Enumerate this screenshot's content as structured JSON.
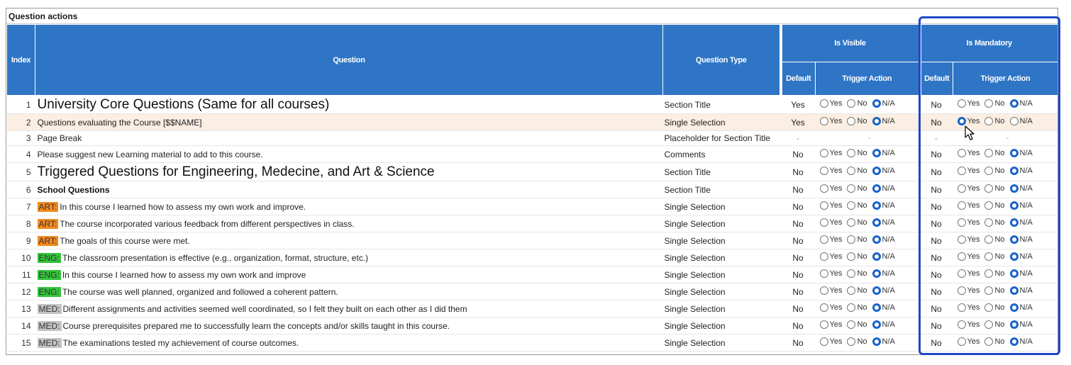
{
  "panel": {
    "title": "Question actions"
  },
  "headers": {
    "index": "Index",
    "question": "Question",
    "question_type": "Question Type",
    "is_visible": "Is Visible",
    "is_mandatory": "Is Mandatory",
    "default": "Default",
    "trigger_action": "Trigger Action"
  },
  "radio_labels": {
    "yes": "Yes",
    "no": "No",
    "na": "N/A"
  },
  "rows": [
    {
      "index": "1",
      "question": "University Core Questions (Same for all courses)",
      "tag": "",
      "style": "big",
      "type": "Section Title",
      "vis_default": "Yes",
      "vis_trigger": "na",
      "man_default": "No",
      "man_trigger": "na",
      "highlight": false,
      "dash": false
    },
    {
      "index": "2",
      "question": "Questions evaluating the Course [$$NAME]",
      "tag": "",
      "style": "",
      "type": "Single Selection",
      "vis_default": "Yes",
      "vis_trigger": "na",
      "man_default": "No",
      "man_trigger": "yes",
      "highlight": true,
      "dash": false
    },
    {
      "index": "3",
      "question": "Page Break",
      "tag": "",
      "style": "sm",
      "type": "Placeholder for Section Title",
      "vis_default": "-",
      "vis_trigger": "-",
      "man_default": "-",
      "man_trigger": "-",
      "highlight": false,
      "dash": true
    },
    {
      "index": "4",
      "question": "Please suggest new Learning material to add to this course.",
      "tag": "",
      "style": "",
      "type": "Comments",
      "vis_default": "No",
      "vis_trigger": "na",
      "man_default": "No",
      "man_trigger": "na",
      "highlight": false,
      "dash": false
    },
    {
      "index": "5",
      "question": "Triggered Questions for Engineering, Medecine, and Art & Science",
      "tag": "",
      "style": "big",
      "type": "Section Title",
      "vis_default": "No",
      "vis_trigger": "na",
      "man_default": "No",
      "man_trigger": "na",
      "highlight": false,
      "dash": false
    },
    {
      "index": "6",
      "question": "School Questions",
      "tag": "",
      "style": "bold",
      "type": "Section Title",
      "vis_default": "No",
      "vis_trigger": "na",
      "man_default": "No",
      "man_trigger": "na",
      "highlight": false,
      "dash": false
    },
    {
      "index": "7",
      "question": "In this course I learned how to assess my own work and improve.",
      "tag": "ART:",
      "style": "",
      "type": "Single Selection",
      "vis_default": "No",
      "vis_trigger": "na",
      "man_default": "No",
      "man_trigger": "na",
      "highlight": false,
      "dash": false
    },
    {
      "index": "8",
      "question": "The course incorporated various feedback from different perspectives in class.",
      "tag": "ART:",
      "style": "",
      "type": "Single Selection",
      "vis_default": "No",
      "vis_trigger": "na",
      "man_default": "No",
      "man_trigger": "na",
      "highlight": false,
      "dash": false
    },
    {
      "index": "9",
      "question": "The goals of this course were met.",
      "tag": "ART:",
      "style": "",
      "type": "Single Selection",
      "vis_default": "No",
      "vis_trigger": "na",
      "man_default": "No",
      "man_trigger": "na",
      "highlight": false,
      "dash": false
    },
    {
      "index": "10",
      "question": "The classroom presentation is effective (e.g., organization, format, structure, etc.)",
      "tag": "ENG:",
      "style": "",
      "type": "Single Selection",
      "vis_default": "No",
      "vis_trigger": "na",
      "man_default": "No",
      "man_trigger": "na",
      "highlight": false,
      "dash": false
    },
    {
      "index": "11",
      "question": "In this course I learned how to assess my own work and improve",
      "tag": "ENG:",
      "style": "",
      "type": "Single Selection",
      "vis_default": "No",
      "vis_trigger": "na",
      "man_default": "No",
      "man_trigger": "na",
      "highlight": false,
      "dash": false
    },
    {
      "index": "12",
      "question": "The course was well planned, organized and followed a coherent pattern.",
      "tag": "ENG:",
      "style": "",
      "type": "Single Selection",
      "vis_default": "No",
      "vis_trigger": "na",
      "man_default": "No",
      "man_trigger": "na",
      "highlight": false,
      "dash": false
    },
    {
      "index": "13",
      "question": "Different assignments and activities seemed well coordinated, so I felt they built on each other as I did them",
      "tag": "MED:",
      "style": "",
      "type": "Single Selection",
      "vis_default": "No",
      "vis_trigger": "na",
      "man_default": "No",
      "man_trigger": "na",
      "highlight": false,
      "dash": false
    },
    {
      "index": "14",
      "question": "Course prerequisites prepared me to successfully learn the concepts and/or skills taught in this course.",
      "tag": "MED:",
      "style": "",
      "type": "Single Selection",
      "vis_default": "No",
      "vis_trigger": "na",
      "man_default": "No",
      "man_trigger": "na",
      "highlight": false,
      "dash": false
    },
    {
      "index": "15",
      "question": "The examinations tested my achievement of course outcomes.",
      "tag": "MED:",
      "style": "",
      "type": "Single Selection",
      "vis_default": "No",
      "vis_trigger": "na",
      "man_default": "No",
      "man_trigger": "na",
      "highlight": false,
      "dash": false
    }
  ],
  "colors": {
    "header_bg": "#2f75c5",
    "highlight_box": "#1e48c6",
    "art_tag": "#f28a1f",
    "eng_tag": "#33c43a",
    "med_tag": "#c4c4c4",
    "radio_selected": "#1b63c9"
  },
  "icons": {
    "cursor": "mouse-pointer-icon"
  }
}
